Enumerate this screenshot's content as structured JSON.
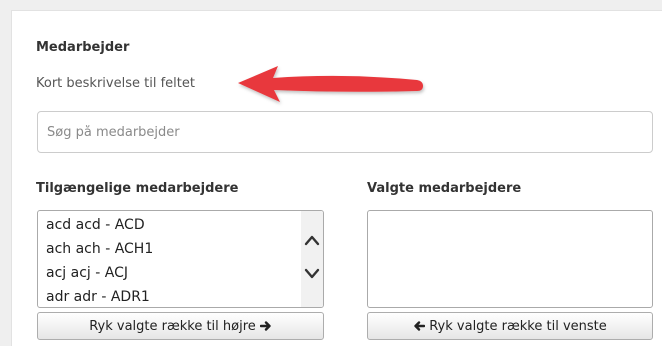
{
  "field": {
    "title": "Medarbejder",
    "description": "Kort beskrivelse til feltet"
  },
  "annotation": {
    "arrow_color": "#e8383d",
    "arrow_icon": "arrow-left-icon"
  },
  "search": {
    "placeholder": "Søg på medarbejder",
    "value": ""
  },
  "available": {
    "title": "Tilgængelige medarbejdere",
    "items": [
      "acd acd - ACD",
      "ach ach - ACH1",
      "acj acj - ACJ",
      "adr adr - ADR1"
    ],
    "scroll_up_icon": "chevron-up-icon",
    "scroll_down_icon": "chevron-down-icon",
    "move_button": {
      "label": "Ryk valgte række til højre",
      "icon": "arrow-right-icon"
    }
  },
  "selected": {
    "title": "Valgte medarbejdere",
    "items": [],
    "move_button": {
      "label": "Ryk valgte række til venste",
      "icon": "arrow-left-icon"
    }
  }
}
